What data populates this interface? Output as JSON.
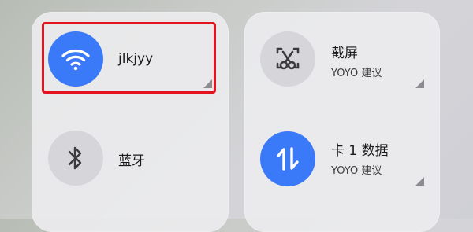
{
  "tiles": {
    "wifi": {
      "label": "jlkjyy",
      "icon": "wifi-icon",
      "state": "on"
    },
    "bluetooth": {
      "label": "蓝牙",
      "icon": "bluetooth-icon",
      "state": "off"
    },
    "screenshot": {
      "label": "截屏",
      "sublabel": "YOYO 建议",
      "icon": "screenshot-scissors-icon",
      "state": "off"
    },
    "mobile_data": {
      "label": "卡 1 数据",
      "sublabel": "YOYO 建议",
      "icon": "data-arrows-icon",
      "state": "on"
    }
  },
  "colors": {
    "active": "#3a79f7",
    "inactive": "#d6d6da",
    "highlight": "#e3141f"
  }
}
